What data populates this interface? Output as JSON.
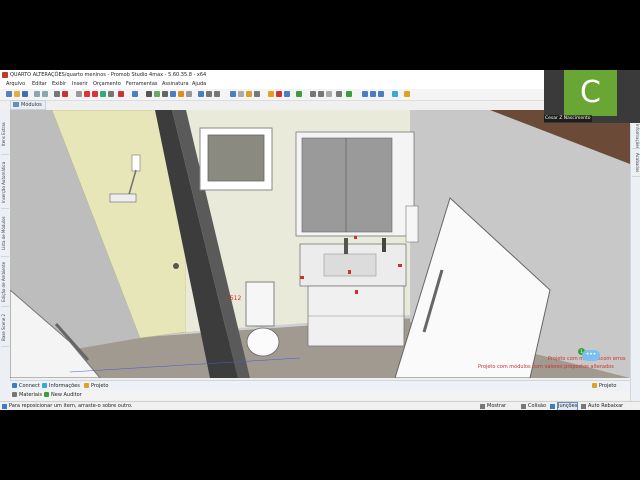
{
  "window": {
    "title": "QUARTO ALTERAÇÕES/quarto meninos - Promob Studio 4max - 5.60.35.8 - x64"
  },
  "menu": [
    "Arquivo",
    "Editar",
    "Exibir",
    "Inserir",
    "Orçamento",
    "Ferramentas",
    "Assinatura",
    "Ajuda"
  ],
  "modules_tab": "Módulos",
  "left_tabs": [
    "Itens Extras",
    "Inserção Automática",
    "Lista de Módulos",
    "Edição de Ambiente",
    "Base Scene 2"
  ],
  "right_tabs": [
    "Informações",
    "Acabados"
  ],
  "bottom_tabs": [
    "Connect",
    "Informações",
    "Projeto"
  ],
  "bottom_right_tab": "Projeto",
  "secondary_tabs": [
    "Materiais",
    "New Auditor"
  ],
  "viewport": {
    "dimension_label": "2512",
    "warnings": [
      "Projeto com móduloscom erros",
      "Projeto com módulos com valores propostos alterados"
    ]
  },
  "status": {
    "hint": "Para reposicionar um item, arraste-o sobre outro.",
    "items": [
      "Mostrar",
      "Colisão",
      "Junções",
      "Auto Rebaixar"
    ]
  },
  "video": {
    "initial": "C",
    "name": "Cesar Z Nascimento"
  },
  "chat": {
    "badge": "1"
  },
  "colors": {
    "wall_yellow": "#e6e6b8",
    "accent_red": "#d0312d",
    "avatar_green": "#6aa633"
  }
}
